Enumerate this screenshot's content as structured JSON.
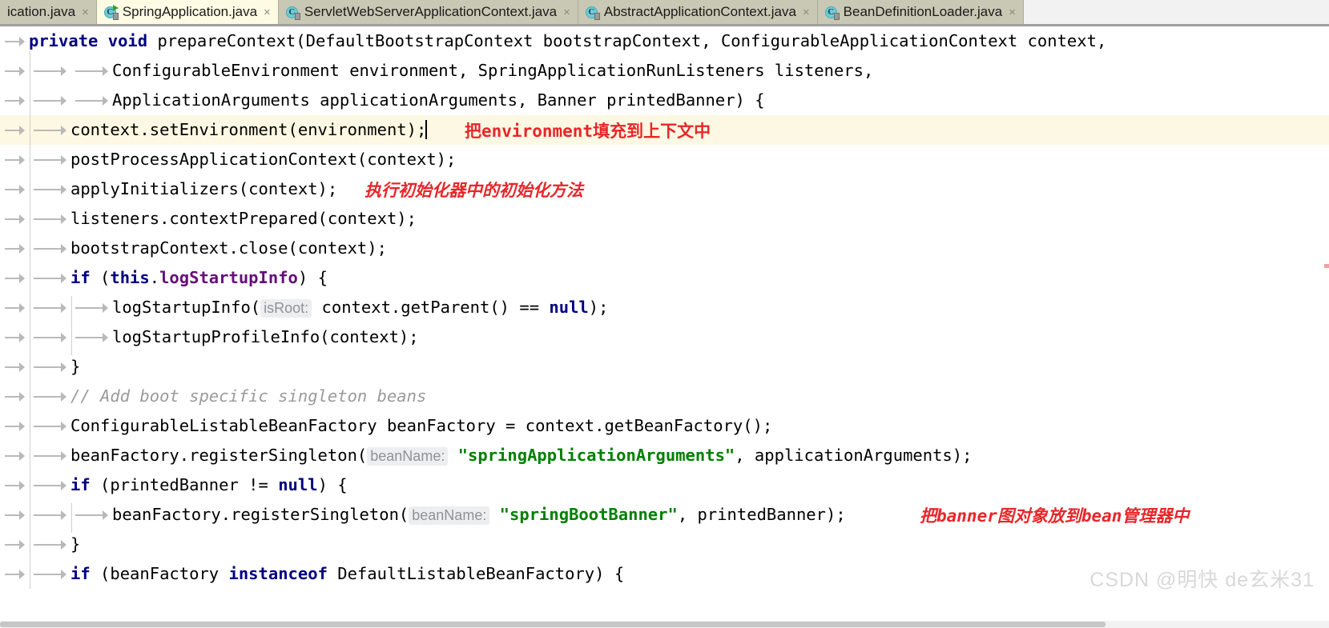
{
  "window": {
    "app": "IntelliJ IDEA",
    "file": "SpringApplication.java"
  },
  "tabs": [
    {
      "label": "ication.java",
      "icon": "java-class-icon",
      "close": "×",
      "active": false,
      "truncated": true,
      "letter": "C"
    },
    {
      "label": "SpringApplication.java",
      "icon": "java-class-runnable-icon",
      "close": "×",
      "active": true,
      "truncated": false,
      "letter": "C"
    },
    {
      "label": "ServletWebServerApplicationContext.java",
      "icon": "java-class-icon",
      "close": "×",
      "active": false,
      "truncated": false,
      "letter": "C"
    },
    {
      "label": "AbstractApplicationContext.java",
      "icon": "java-class-icon",
      "close": "×",
      "active": false,
      "truncated": false,
      "letter": "C"
    },
    {
      "label": "BeanDefinitionLoader.java",
      "icon": "java-class-icon",
      "close": "×",
      "active": false,
      "truncated": false,
      "letter": "C"
    }
  ],
  "code": {
    "lines": [
      {
        "id": "l1",
        "tokens": [
          {
            "t": "private",
            "c": "kw"
          },
          {
            "t": " ",
            "c": "plain"
          },
          {
            "t": "void",
            "c": "kw"
          },
          {
            "t": " prepareContext(DefaultBootstrapContext bootstrapContext, ConfigurableApplicationContext context,",
            "c": "plain"
          }
        ]
      },
      {
        "id": "l2",
        "tokens": [
          {
            "t": "ConfigurableEnvironment environment, SpringApplicationRunListeners listeners,",
            "c": "plain"
          }
        ]
      },
      {
        "id": "l3",
        "tokens": [
          {
            "t": "ApplicationArguments applicationArguments, Banner printedBanner) {",
            "c": "plain"
          }
        ]
      },
      {
        "id": "l4",
        "tokens": [
          {
            "t": "context.setEnvironment(environment);",
            "c": "plain"
          }
        ]
      },
      {
        "id": "l5",
        "tokens": [
          {
            "t": "postProcessApplicationContext(context);",
            "c": "plain"
          }
        ]
      },
      {
        "id": "l6",
        "tokens": [
          {
            "t": "applyInitializers(context);",
            "c": "plain"
          }
        ]
      },
      {
        "id": "l7",
        "tokens": [
          {
            "t": "listeners.contextPrepared(context);",
            "c": "plain"
          }
        ]
      },
      {
        "id": "l8",
        "tokens": [
          {
            "t": "bootstrapContext.close(context);",
            "c": "plain"
          }
        ]
      },
      {
        "id": "l9",
        "tokens": [
          {
            "t": "if",
            "c": "kw"
          },
          {
            "t": " (",
            "c": "plain"
          },
          {
            "t": "this",
            "c": "kw"
          },
          {
            "t": ".",
            "c": "plain"
          },
          {
            "t": "logStartupInfo",
            "c": "fld"
          },
          {
            "t": ") {",
            "c": "plain"
          }
        ]
      },
      {
        "id": "l10",
        "tokens": [
          {
            "t": "logStartupInfo(",
            "c": "plain"
          },
          {
            "t": "isRoot:",
            "c": "hint"
          },
          {
            "t": " context.getParent() == ",
            "c": "plain"
          },
          {
            "t": "null",
            "c": "kw"
          },
          {
            "t": ");",
            "c": "plain"
          }
        ]
      },
      {
        "id": "l11",
        "tokens": [
          {
            "t": "logStartupProfileInfo(context);",
            "c": "plain"
          }
        ]
      },
      {
        "id": "l12",
        "tokens": [
          {
            "t": "}",
            "c": "plain"
          }
        ]
      },
      {
        "id": "l13",
        "tokens": [
          {
            "t": "// Add boot specific singleton beans",
            "c": "cmt"
          }
        ]
      },
      {
        "id": "l14",
        "tokens": [
          {
            "t": "ConfigurableListableBeanFactory beanFactory = context.getBeanFactory();",
            "c": "plain"
          }
        ]
      },
      {
        "id": "l15",
        "tokens": [
          {
            "t": "beanFactory.registerSingleton(",
            "c": "plain"
          },
          {
            "t": "beanName:",
            "c": "hint"
          },
          {
            "t": " ",
            "c": "plain"
          },
          {
            "t": "\"springApplicationArguments\"",
            "c": "str"
          },
          {
            "t": ", applicationArguments);",
            "c": "plain"
          }
        ]
      },
      {
        "id": "l16",
        "tokens": [
          {
            "t": "if",
            "c": "kw"
          },
          {
            "t": " (printedBanner != ",
            "c": "plain"
          },
          {
            "t": "null",
            "c": "kw"
          },
          {
            "t": ") {",
            "c": "plain"
          }
        ]
      },
      {
        "id": "l17",
        "tokens": [
          {
            "t": "beanFactory.registerSingleton(",
            "c": "plain"
          },
          {
            "t": "beanName:",
            "c": "hint"
          },
          {
            "t": " ",
            "c": "plain"
          },
          {
            "t": "\"springBootBanner\"",
            "c": "str"
          },
          {
            "t": ", printedBanner);",
            "c": "plain"
          }
        ]
      },
      {
        "id": "l18",
        "tokens": [
          {
            "t": "}",
            "c": "plain"
          }
        ]
      },
      {
        "id": "l19",
        "tokens": [
          {
            "t": "if",
            "c": "kw"
          },
          {
            "t": " (beanFactory ",
            "c": "plain"
          },
          {
            "t": "instanceof",
            "c": "kw"
          },
          {
            "t": " DefaultListableBeanFactory) {",
            "c": "plain"
          }
        ]
      }
    ]
  },
  "annotations": [
    {
      "id": "a1",
      "text": "把environment填充到上下文中",
      "line": 4
    },
    {
      "id": "a2",
      "text": "执行初始化器中的初始化方法",
      "line": 6
    },
    {
      "id": "a3",
      "text": "把banner图对象放到bean管理器中",
      "line": 17
    }
  ],
  "watermark": {
    "text": "CSDN @明快 de玄米31"
  },
  "colors": {
    "tab_bar": "#c9c8b4",
    "tab_active": "#fdfbe3",
    "line_highlight": "#fdf8e3",
    "keyword": "#000080",
    "string": "#008000",
    "field": "#660e7a",
    "comment": "#9a9a9a",
    "annotation_red": "#e8262a"
  }
}
